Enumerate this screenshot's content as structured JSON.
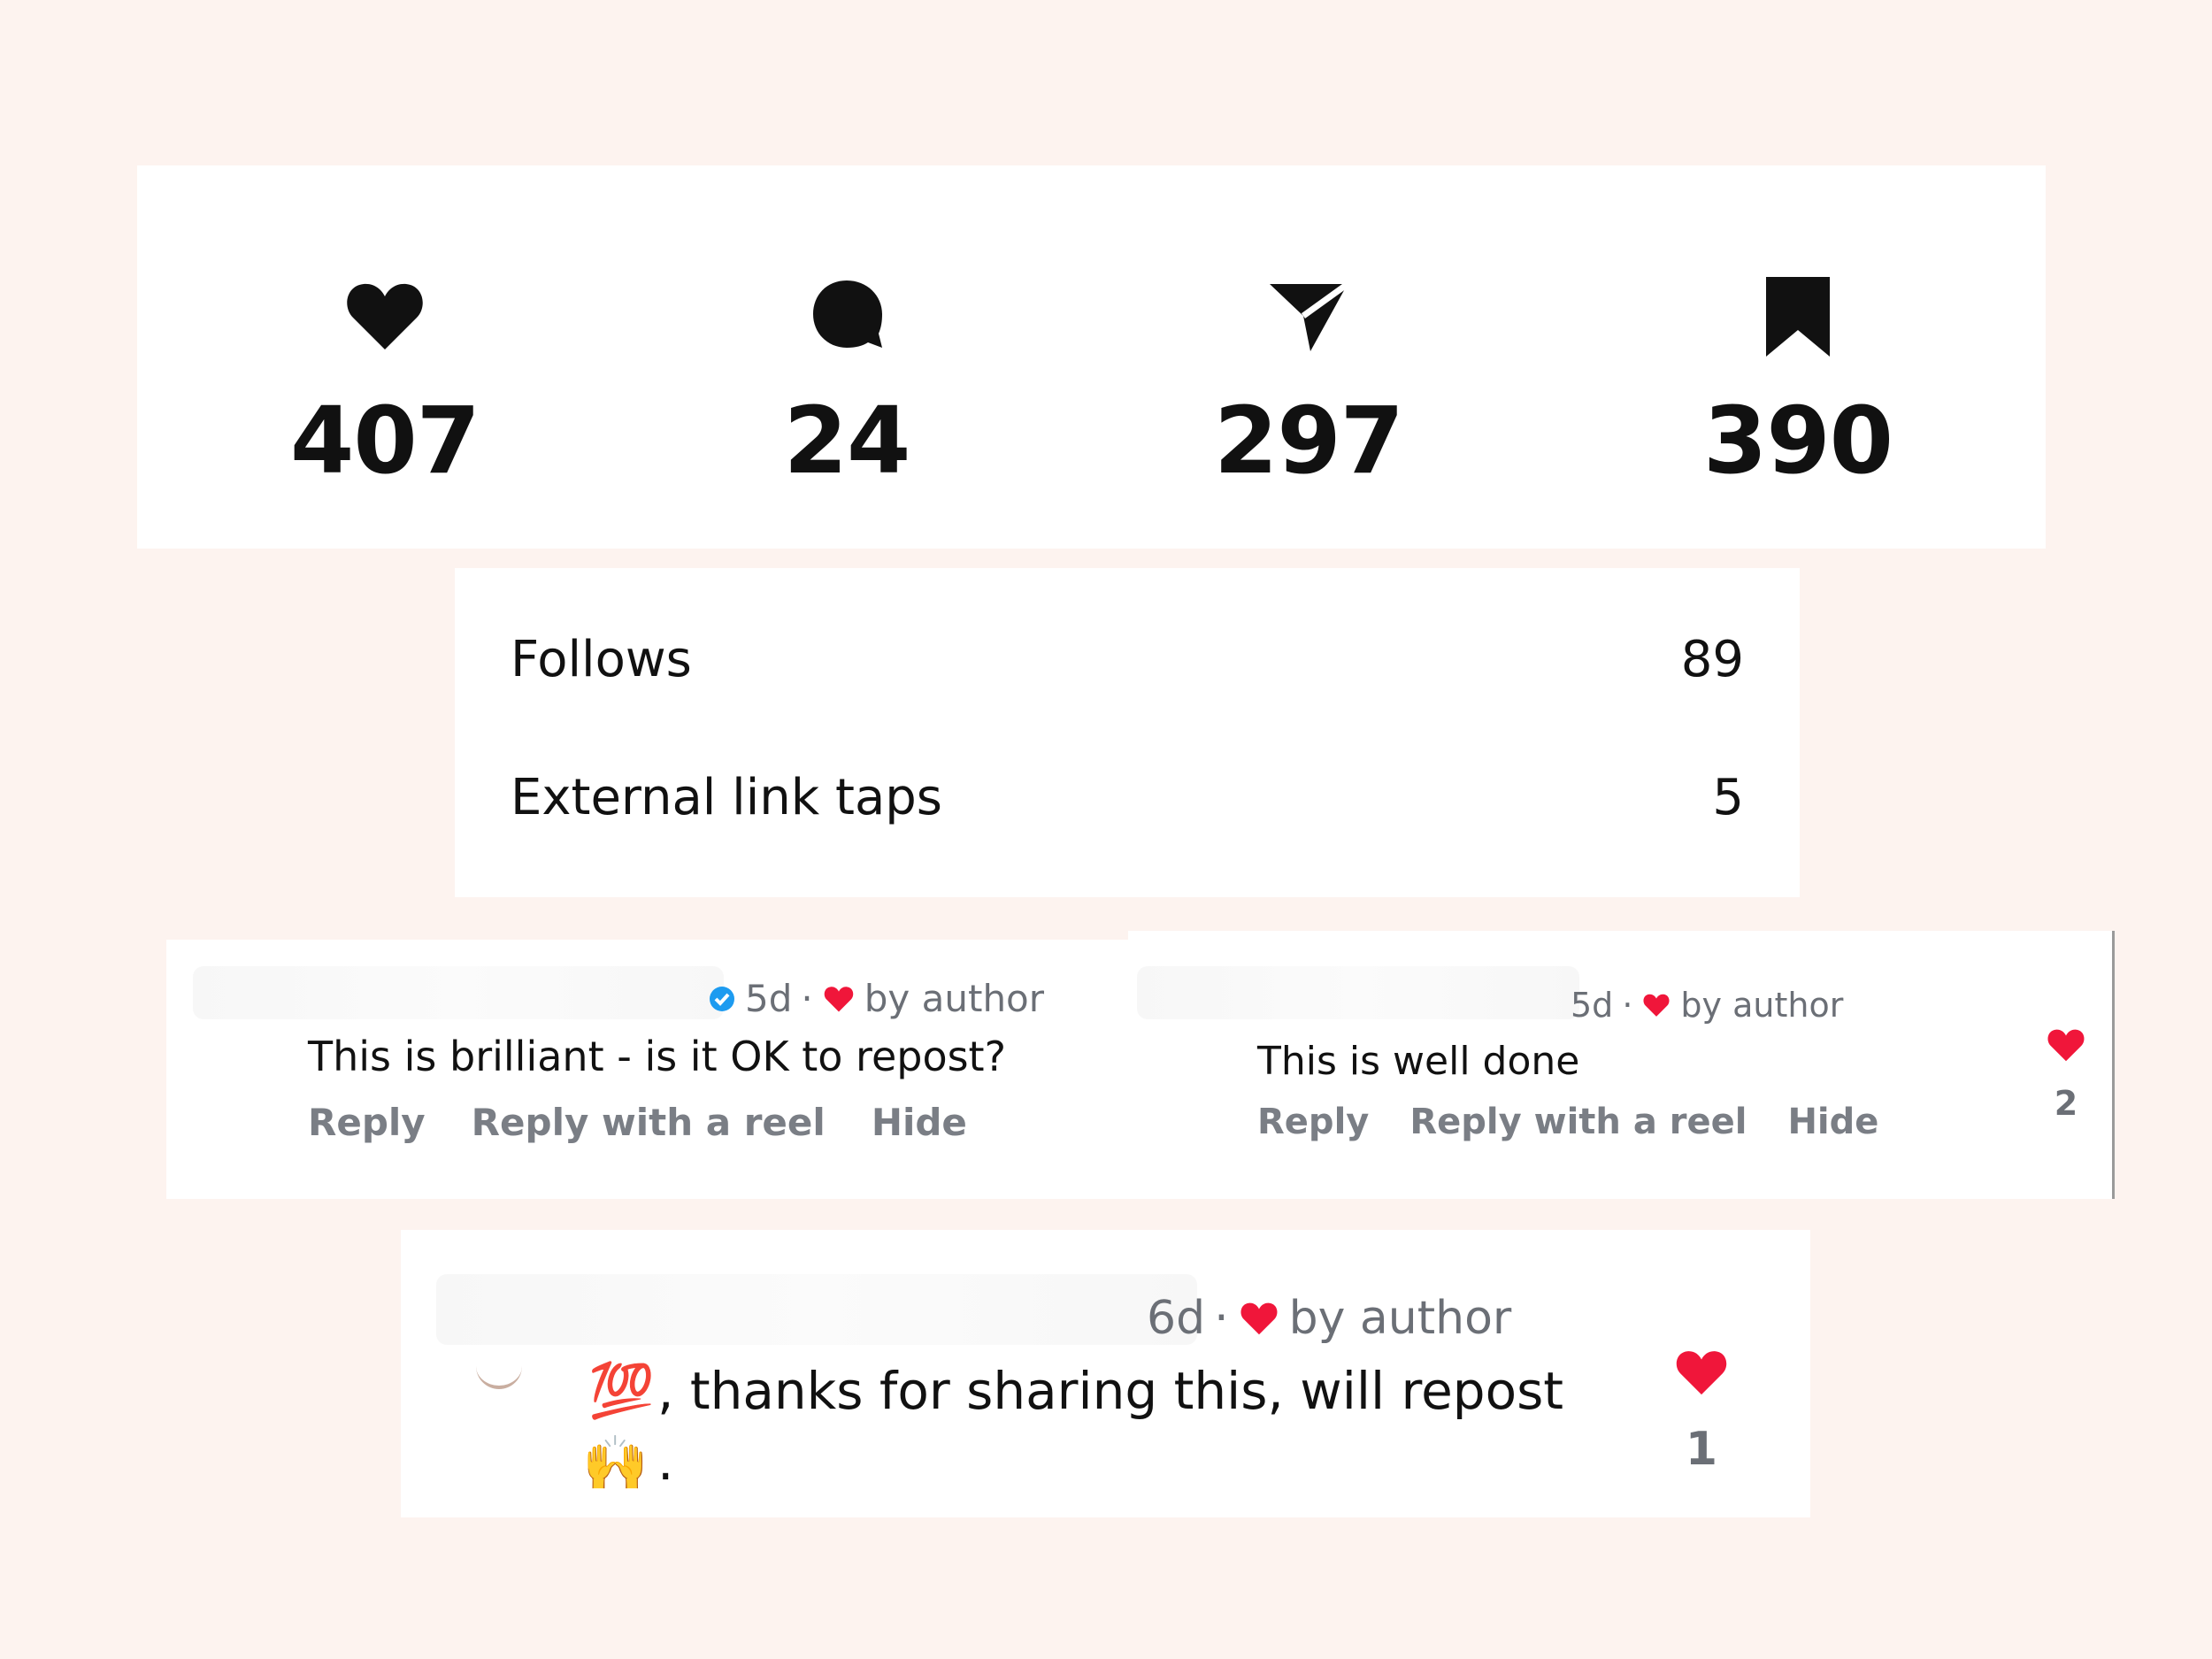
{
  "stats": {
    "likes": {
      "icon": "heart-icon",
      "value": "407"
    },
    "comments": {
      "icon": "comment-bubble-icon",
      "value": "24"
    },
    "shares": {
      "icon": "send-icon",
      "value": "297"
    },
    "saves": {
      "icon": "bookmark-icon",
      "value": "390"
    }
  },
  "metrics": [
    {
      "label": "Follows",
      "value": "89"
    },
    {
      "label": "External link taps",
      "value": "5"
    }
  ],
  "comments": [
    {
      "time": "5d",
      "liked_label": "by author",
      "text": "This is brilliant - is it OK to repost?",
      "actions": [
        "Reply",
        "Reply with a reel",
        "Hide"
      ]
    },
    {
      "time": "5d",
      "liked_label": "by author",
      "text": "This is well done",
      "actions": [
        "Reply",
        "Reply with a reel",
        "Hide"
      ],
      "like_count": "2"
    },
    {
      "time": "6d",
      "liked_label": "by author",
      "text_line1": ", thanks for sharing this, will repost",
      "text_line2": ".",
      "emoji1": "💯",
      "emoji2": "🙌",
      "like_count": "1"
    }
  ],
  "colors": {
    "background": "#fdf3ef",
    "heart_red": "#f0163a",
    "verified_blue": "#1d9bf0",
    "muted_text": "#6b6f76"
  }
}
